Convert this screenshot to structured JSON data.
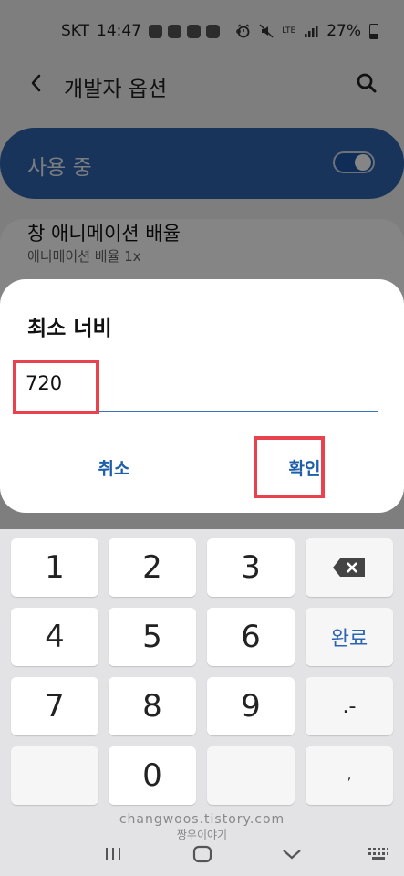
{
  "status_bar": {
    "carrier": "SKT",
    "time": "14:47",
    "network": "LTE",
    "battery": "27%"
  },
  "app_bar": {
    "title": "개발자 옵션"
  },
  "master_switch": {
    "label": "사용 중",
    "state": "on"
  },
  "setting_item": {
    "title": "창 애니메이션 배율",
    "subtitle": "애니메이션 배율 1x"
  },
  "dialog": {
    "title": "최소 너비",
    "input_value": "720",
    "cancel_label": "취소",
    "ok_label": "확인"
  },
  "keyboard": {
    "keys": [
      "1",
      "2",
      "3",
      "4",
      "5",
      "6",
      "7",
      "8",
      "9",
      "0"
    ],
    "done_label": "완료",
    "punct_label": ".-",
    "comma_label": ","
  },
  "watermark": {
    "url": "changwoos.tistory.com",
    "name": "짱우이야기"
  },
  "colors": {
    "accent": "#1e5fa8",
    "highlight": "#e8424f",
    "master_bar": "#2f64ad"
  }
}
